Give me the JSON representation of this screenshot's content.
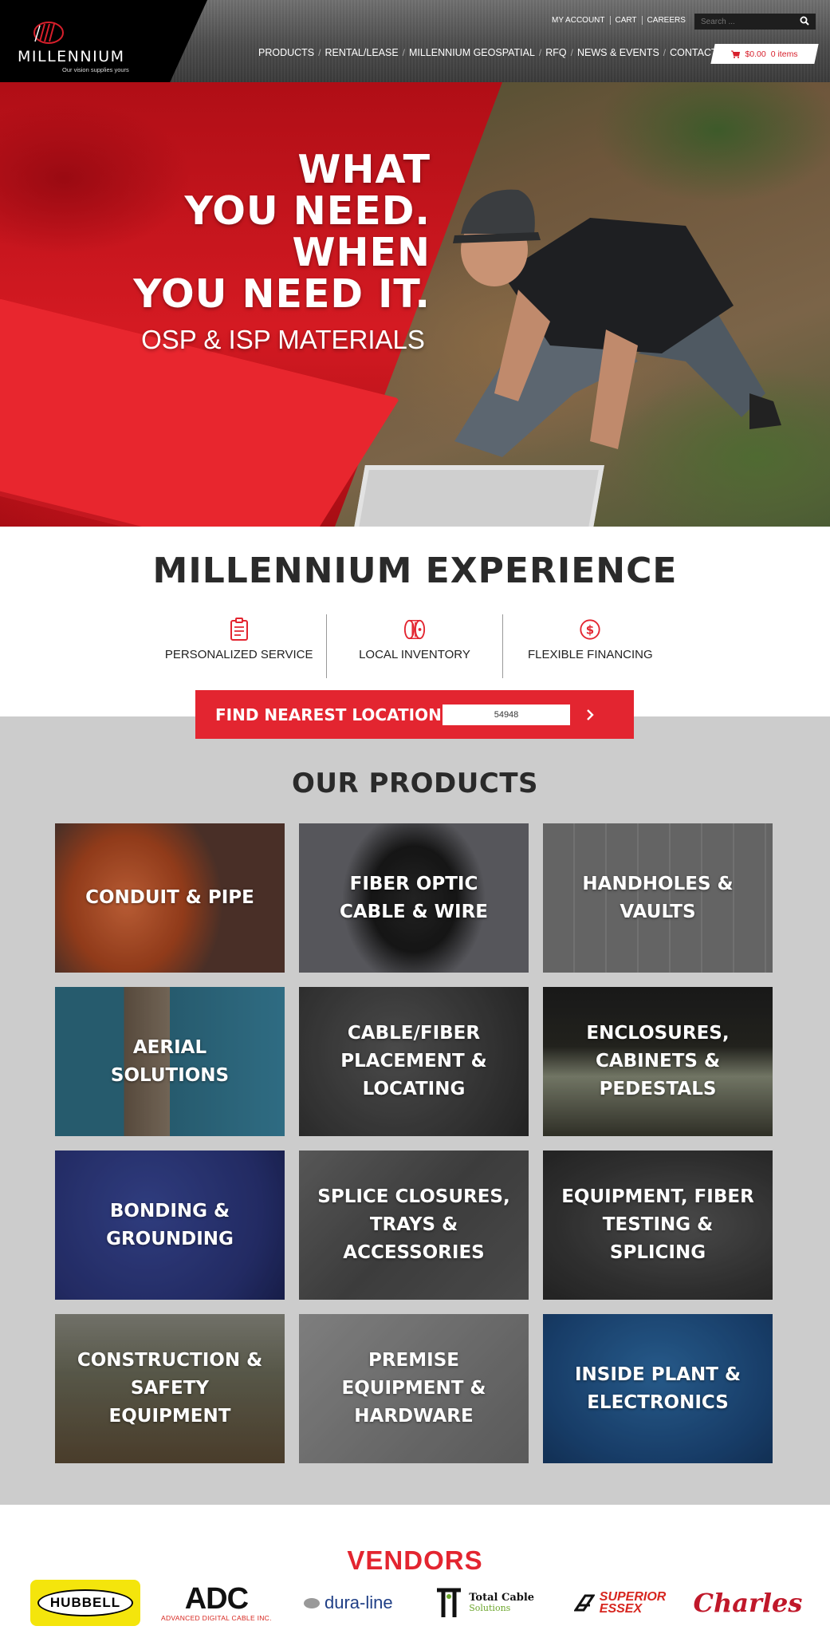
{
  "brand": {
    "name": "MILLENNIUM",
    "tagline": "Our vision supplies yours"
  },
  "utility_nav": [
    "MY ACCOUNT",
    "CART",
    "CAREERS"
  ],
  "search": {
    "placeholder": "Search ..."
  },
  "main_nav": [
    "PRODUCTS",
    "RENTAL/LEASE",
    "MILLENNIUM GEOSPATIAL",
    "RFQ",
    "NEWS & EVENTS",
    "CONTACT US"
  ],
  "cart": {
    "amount": "$0.00",
    "items": "0 items"
  },
  "hero": {
    "lines": [
      "WHAT",
      "YOU NEED.",
      "WHEN",
      "YOU NEED IT."
    ],
    "subtitle": "OSP & ISP MATERIALS"
  },
  "experience": {
    "title": "MILLENNIUM EXPERIENCE",
    "features": [
      {
        "label": "PERSONALIZED SERVICE",
        "icon": "clipboard-icon"
      },
      {
        "label": "LOCAL INVENTORY",
        "icon": "cable-reel-icon"
      },
      {
        "label": "FLEXIBLE FINANCING",
        "icon": "dollar-icon"
      }
    ]
  },
  "find_location": {
    "label": "FIND NEAREST LOCATION",
    "zip": "54948"
  },
  "products": {
    "title": "OUR PRODUCTS",
    "items": [
      "CONDUIT & PIPE",
      "FIBER OPTIC CABLE & WIRE",
      "HANDHOLES & VAULTS",
      "AERIAL SOLUTIONS",
      "CABLE/FIBER PLACEMENT & LOCATING",
      "ENCLOSURES, CABINETS & PEDESTALS",
      "BONDING & GROUNDING",
      "SPLICE CLOSURES, TRAYS & ACCESSORIES",
      "EQUIPMENT, FIBER TESTING & SPLICING",
      "CONSTRUCTION & SAFETY EQUIPMENT",
      "PREMISE EQUIPMENT & HARDWARE",
      "INSIDE PLANT & ELECTRONICS"
    ]
  },
  "vendors": {
    "title": "VENDORS",
    "hubbell": "HUBBELL",
    "adc": "ADC",
    "adc_sub": "ADVANCED DIGITAL CABLE INC.",
    "duraline": "dura-line",
    "total_cable_1": "Total Cable",
    "total_cable_2": "Solutions",
    "superior_1": "SUPERIOR",
    "superior_2": "ESSEX",
    "charles": "Charles"
  },
  "colors": {
    "accent": "#e32530",
    "header": "#4c4c4c",
    "products_bg": "#cccccc"
  }
}
